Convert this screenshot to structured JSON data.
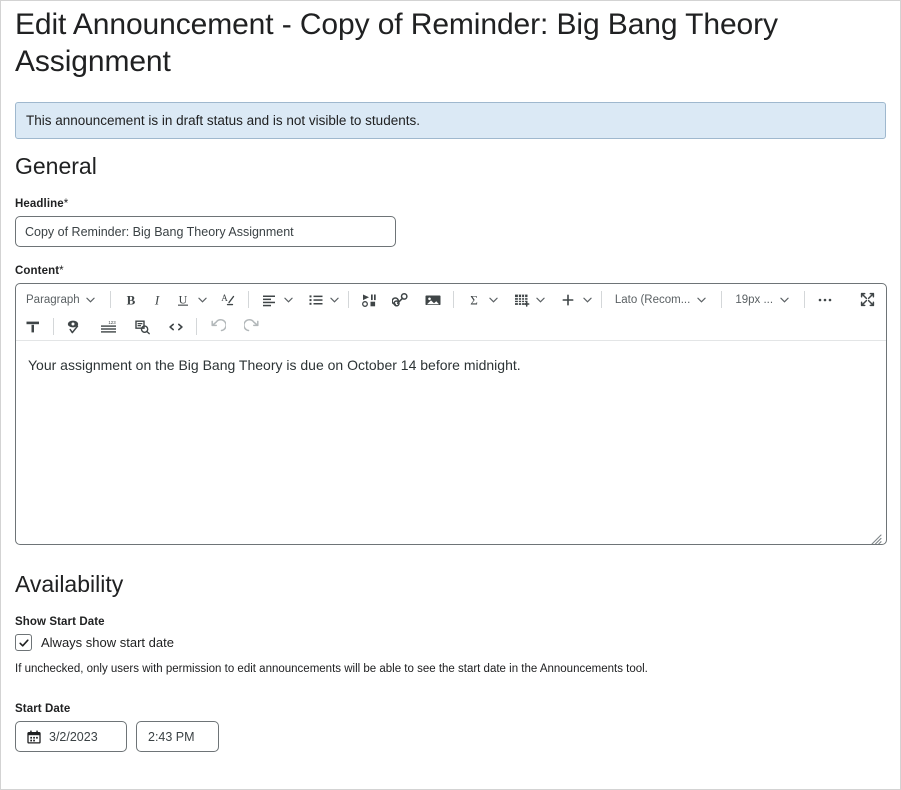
{
  "page": {
    "title": "Edit Announcement - Copy of Reminder: Big Bang Theory Assignment",
    "status_banner": "This announcement is in draft status and is not visible to students.",
    "banner_bg": "#dbe9f5",
    "banner_border": "#9fb8ce"
  },
  "general": {
    "heading": "General",
    "headline_label": "Headline",
    "headline_required_mark": "*",
    "headline_value": "Copy of Reminder: Big Bang Theory Assignment",
    "headline_placeholder": "",
    "content_label": "Content",
    "content_required_mark": "*",
    "content_text": "Your assignment on the Big Bang Theory is due on October 14 before midnight."
  },
  "editor_toolbar": {
    "row1": [
      {
        "name": "paragraph-style-select",
        "type": "select",
        "label": "Paragraph"
      },
      {
        "name": "bold-icon",
        "type": "icon",
        "label": "B"
      },
      {
        "name": "italic-icon",
        "type": "icon",
        "label": "I"
      },
      {
        "name": "underline-icon",
        "type": "icon",
        "label": "U"
      },
      {
        "name": "text-color-icon",
        "type": "icon",
        "label": "A"
      },
      {
        "name": "align-left-icon",
        "type": "icon"
      },
      {
        "name": "bulleted-list-icon",
        "type": "icon"
      },
      {
        "name": "insert-media-icon",
        "type": "icon"
      },
      {
        "name": "insert-link-icon",
        "type": "icon"
      },
      {
        "name": "insert-image-icon",
        "type": "icon"
      },
      {
        "name": "insert-equation-icon",
        "type": "icon",
        "label": "Σ"
      },
      {
        "name": "insert-table-icon",
        "type": "icon"
      },
      {
        "name": "insert-more-icon",
        "type": "icon",
        "label": "+"
      },
      {
        "name": "font-family-select",
        "type": "select",
        "label": "Lato (Recom..."
      },
      {
        "name": "font-size-select",
        "type": "select",
        "label": "19px ..."
      },
      {
        "name": "overflow-menu-icon",
        "type": "icon",
        "label": "•••"
      },
      {
        "name": "fullscreen-icon",
        "type": "icon"
      }
    ],
    "row2": [
      {
        "name": "format-painter-icon",
        "type": "icon"
      },
      {
        "name": "accessibility-checker-icon",
        "type": "icon"
      },
      {
        "name": "word-count-icon",
        "type": "icon"
      },
      {
        "name": "preview-icon",
        "type": "icon"
      },
      {
        "name": "source-code-icon",
        "type": "icon",
        "label": "</>"
      },
      {
        "name": "undo-icon",
        "type": "icon"
      },
      {
        "name": "redo-icon",
        "type": "icon"
      }
    ],
    "font_family_label": "Lato (Recom...",
    "font_size_label": "19px ...",
    "paragraph_label": "Paragraph"
  },
  "availability": {
    "heading": "Availability",
    "show_start_date_label": "Show Start Date",
    "always_show_checkbox_label": "Always show start date",
    "always_show_checked": true,
    "help_text": "If unchecked, only users with permission to edit announcements will be able to see the start date in the Announcements tool.",
    "start_date_label": "Start Date",
    "start_date_value": "3/2/2023",
    "start_time_value": "2:43 PM"
  }
}
